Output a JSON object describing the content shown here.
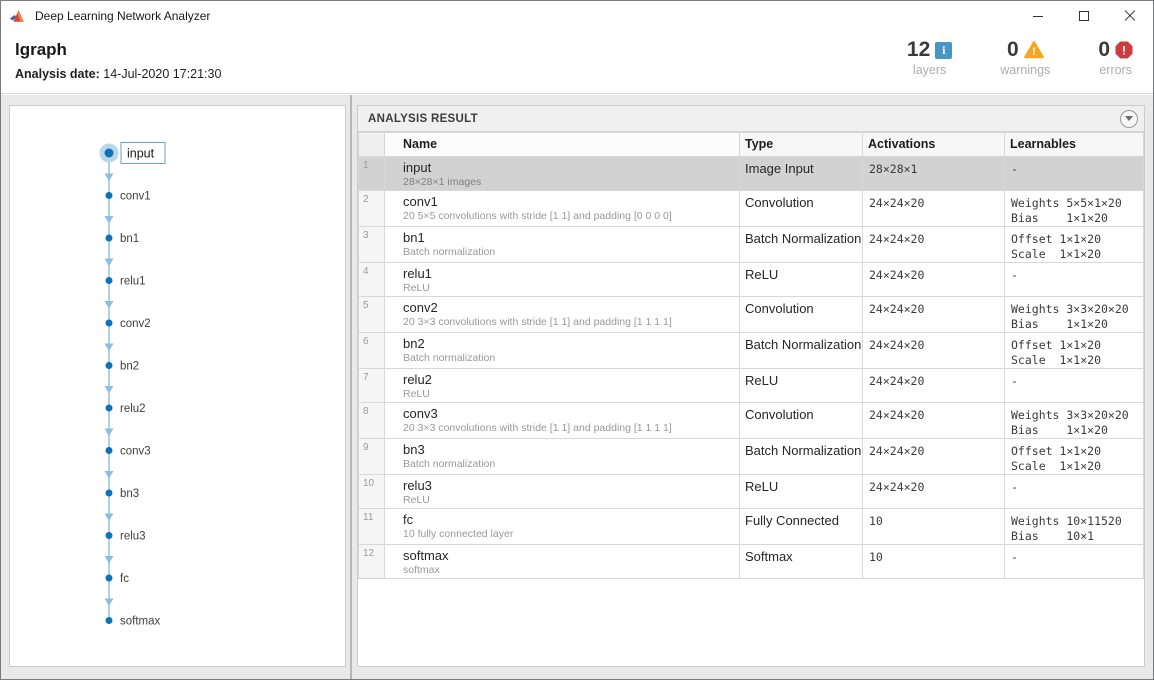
{
  "window": {
    "title": "Deep Learning Network Analyzer"
  },
  "header": {
    "title": "lgraph",
    "analysis_date_label": "Analysis date:",
    "analysis_date": "14-Jul-2020 17:21:30",
    "stats": [
      {
        "value": "12",
        "label": "layers",
        "icon": "info-icon"
      },
      {
        "value": "0",
        "label": "warnings",
        "icon": "warning-icon"
      },
      {
        "value": "0",
        "label": "errors",
        "icon": "error-icon"
      }
    ]
  },
  "graph": {
    "nodes": [
      {
        "label": "input",
        "selected": true
      },
      {
        "label": "conv1",
        "selected": false
      },
      {
        "label": "bn1",
        "selected": false
      },
      {
        "label": "relu1",
        "selected": false
      },
      {
        "label": "conv2",
        "selected": false
      },
      {
        "label": "bn2",
        "selected": false
      },
      {
        "label": "relu2",
        "selected": false
      },
      {
        "label": "conv3",
        "selected": false
      },
      {
        "label": "bn3",
        "selected": false
      },
      {
        "label": "relu3",
        "selected": false
      },
      {
        "label": "fc",
        "selected": false
      },
      {
        "label": "softmax",
        "selected": false
      }
    ]
  },
  "analysis": {
    "panel_title": "ANALYSIS RESULT",
    "columns": [
      "",
      "Name",
      "Type",
      "Activations",
      "Learnables"
    ],
    "rows": [
      {
        "num": 1,
        "name": "input",
        "description": "28×28×1 images",
        "type": "Image Input",
        "activations": "28×28×1",
        "learnables": [
          "-"
        ],
        "selected": true
      },
      {
        "num": 2,
        "name": "conv1",
        "description": "20 5×5 convolutions with stride [1 1] and padding [0 0 0 0]",
        "type": "Convolution",
        "activations": "24×24×20",
        "learnables": [
          "Weights 5×5×1×20",
          "Bias    1×1×20"
        ],
        "selected": false
      },
      {
        "num": 3,
        "name": "bn1",
        "description": "Batch normalization",
        "type": "Batch Normalization",
        "activations": "24×24×20",
        "learnables": [
          "Offset 1×1×20",
          "Scale  1×1×20"
        ],
        "selected": false
      },
      {
        "num": 4,
        "name": "relu1",
        "description": "ReLU",
        "type": "ReLU",
        "activations": "24×24×20",
        "learnables": [
          "-"
        ],
        "selected": false
      },
      {
        "num": 5,
        "name": "conv2",
        "description": "20 3×3 convolutions with stride [1 1] and padding [1 1 1 1]",
        "type": "Convolution",
        "activations": "24×24×20",
        "learnables": [
          "Weights 3×3×20×20",
          "Bias    1×1×20"
        ],
        "selected": false
      },
      {
        "num": 6,
        "name": "bn2",
        "description": "Batch normalization",
        "type": "Batch Normalization",
        "activations": "24×24×20",
        "learnables": [
          "Offset 1×1×20",
          "Scale  1×1×20"
        ],
        "selected": false
      },
      {
        "num": 7,
        "name": "relu2",
        "description": "ReLU",
        "type": "ReLU",
        "activations": "24×24×20",
        "learnables": [
          "-"
        ],
        "selected": false
      },
      {
        "num": 8,
        "name": "conv3",
        "description": "20 3×3 convolutions with stride [1 1] and padding [1 1 1 1]",
        "type": "Convolution",
        "activations": "24×24×20",
        "learnables": [
          "Weights 3×3×20×20",
          "Bias    1×1×20"
        ],
        "selected": false
      },
      {
        "num": 9,
        "name": "bn3",
        "description": "Batch normalization",
        "type": "Batch Normalization",
        "activations": "24×24×20",
        "learnables": [
          "Offset 1×1×20",
          "Scale  1×1×20"
        ],
        "selected": false
      },
      {
        "num": 10,
        "name": "relu3",
        "description": "ReLU",
        "type": "ReLU",
        "activations": "24×24×20",
        "learnables": [
          "-"
        ],
        "selected": false
      },
      {
        "num": 11,
        "name": "fc",
        "description": "10 fully connected layer",
        "type": "Fully Connected",
        "activations": "10",
        "learnables": [
          "Weights 10×11520",
          "Bias    10×1"
        ],
        "selected": false
      },
      {
        "num": 12,
        "name": "softmax",
        "description": "softmax",
        "type": "Softmax",
        "activations": "10",
        "learnables": [
          "-"
        ],
        "selected": false
      }
    ]
  },
  "colors": {
    "info_blue": "#4796c6",
    "warning_orange": "#f6a621",
    "error_red": "#ce3c3d",
    "node_blue": "#0d72b9",
    "edge_blue": "#aed0e8",
    "arrow_blue": "#8cbedf",
    "halo_blue": "#b9d6ea",
    "selection_gray": "#d2d2d2"
  }
}
